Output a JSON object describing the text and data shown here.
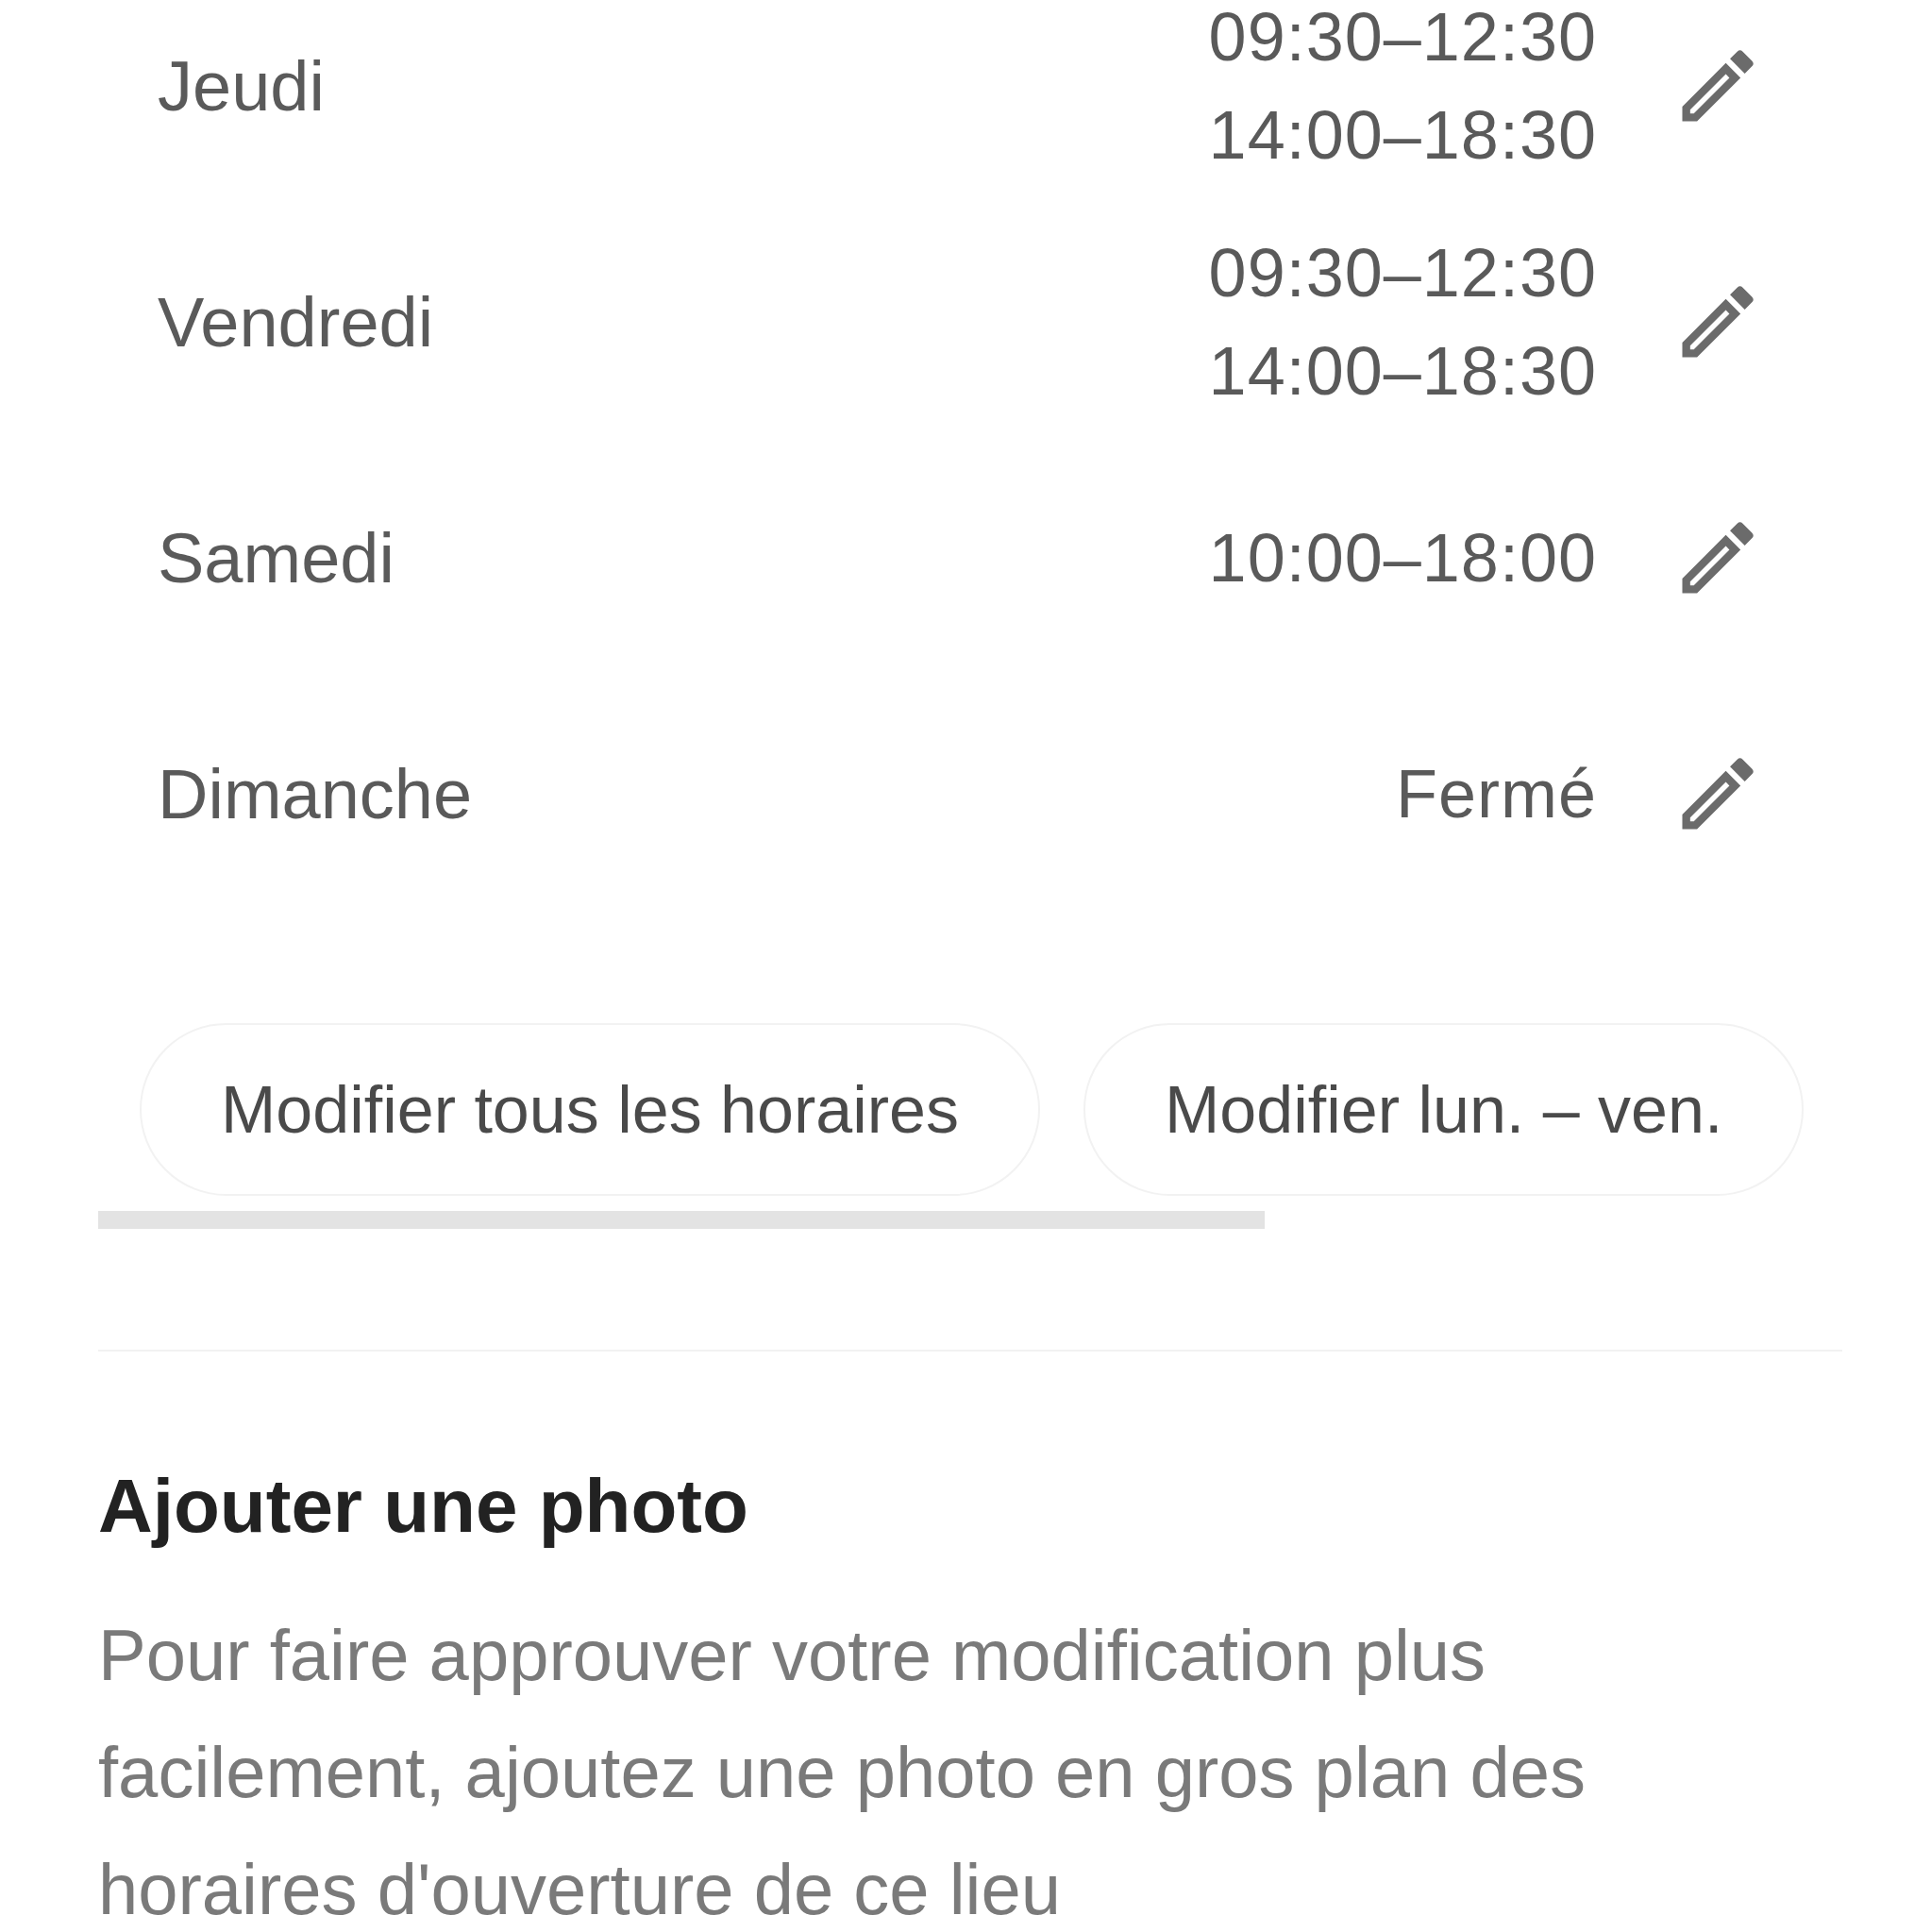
{
  "hours": [
    {
      "day": "Jeudi",
      "times": [
        "09:30–12:30",
        "14:00–18:30"
      ]
    },
    {
      "day": "Vendredi",
      "times": [
        "09:30–12:30",
        "14:00–18:30"
      ]
    },
    {
      "day": "Samedi",
      "times": [
        "10:00–18:00"
      ]
    },
    {
      "day": "Dimanche",
      "times": [
        "Fermé"
      ]
    }
  ],
  "actions": [
    "Modifier tous les horaires",
    "Modifier lun. – ven."
  ],
  "photo_section": {
    "title": "Ajouter une photo",
    "text": "Pour faire approuver votre modification plus facilement, ajoutez une photo en gros plan des horaires d'ouverture de ce lieu"
  }
}
